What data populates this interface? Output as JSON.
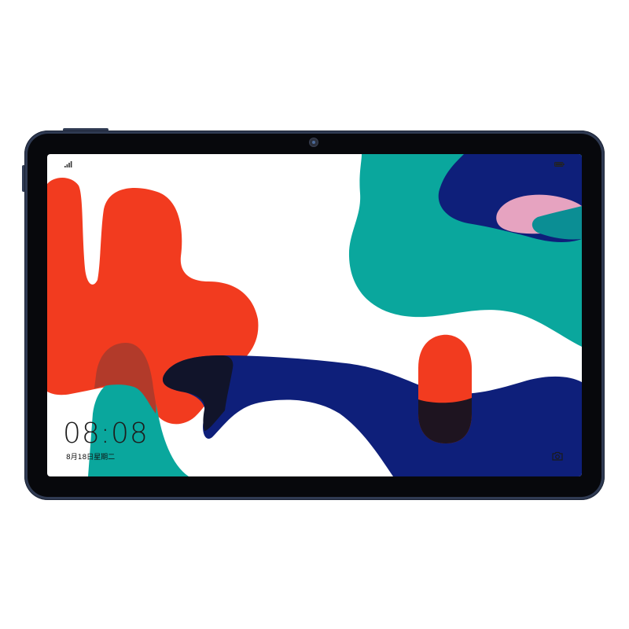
{
  "lock_screen": {
    "time": "08:08",
    "date": "8月18日星期二"
  },
  "icons": {
    "signal": "signal-icon",
    "battery": "battery-icon",
    "camera_shortcut": "camera-icon",
    "front_camera": "front-camera-icon"
  },
  "colors": {
    "device_frame": "#2f3a52",
    "bezel": "#07080c",
    "red": "#f23b1f",
    "teal": "#0aa79d",
    "navy": "#0e1f7a",
    "pink": "#e6a3c0",
    "dark_overlap": "#11142a",
    "red_overlap": "#b23a2a"
  }
}
